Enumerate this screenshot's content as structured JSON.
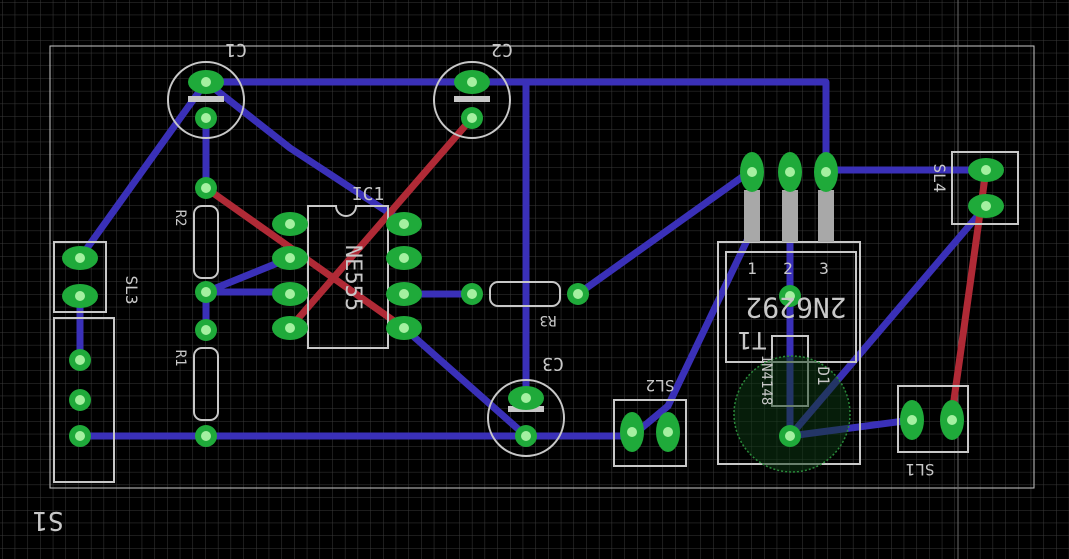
{
  "colors": {
    "background": "#000000",
    "grid": "#3a3a3a",
    "outline": "#c8c8c8",
    "bottom_trace": "#3a30b8",
    "top_trace": "#b02a36",
    "pad": "#1faa3a",
    "hole": "#a4f0a0"
  },
  "labels": {
    "c1": "C1",
    "c2": "C2",
    "c3": "C3",
    "ic1": "IC1",
    "ic1_value": "NE555",
    "r1": "R1",
    "r2": "R2",
    "r3": "R3",
    "sl1": "SL1",
    "sl2": "SL2",
    "sl3": "SL3",
    "sl4": "SL4",
    "s1": "S1",
    "d1": "D1",
    "transistor": "2N6292",
    "transistor_pkg": "T1",
    "diode_value": "1N4148",
    "pin1": "1",
    "pin2": "2",
    "pin3": "3"
  }
}
